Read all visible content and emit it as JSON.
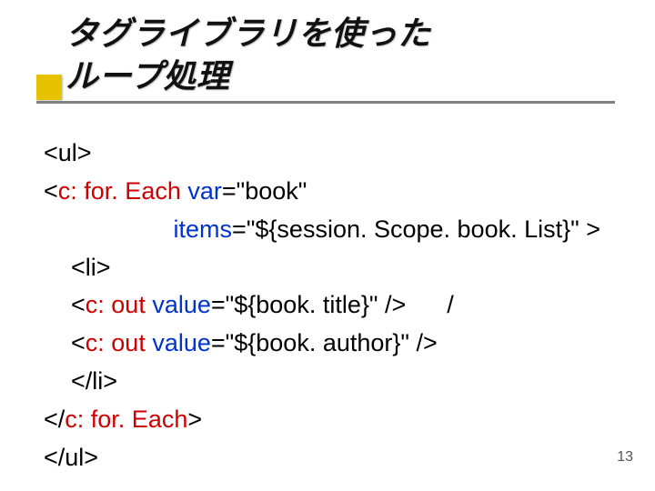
{
  "slide": {
    "title_line1": "タグライブラリを使った",
    "title_line2": "ループ処理",
    "page_number": "13"
  },
  "code": {
    "l1": {
      "t0": "<ul>"
    },
    "l2": {
      "t0": "<",
      "t1": "c: for. Each",
      "t2": " ",
      "t3": "var",
      "t4": "=\"book\""
    },
    "l3": {
      "t0": "                   ",
      "t1": "items",
      "t2": "=\"${session. Scope. book. List}\" >"
    },
    "l4": {
      "t0": "    <li>"
    },
    "l5": {
      "t0": "    <",
      "t1": "c: out",
      "t2": " ",
      "t3": "value",
      "t4": "=\"${book. title}\" />      /"
    },
    "l6": {
      "t0": "    <",
      "t1": "c: out",
      "t2": " ",
      "t3": "value",
      "t4": "=\"${book. author}\" />"
    },
    "l7": {
      "t0": "    </li>"
    },
    "l8": {
      "t0": "</",
      "t1": "c: for. Each",
      "t2": ">"
    },
    "l9": {
      "t0": "</ul>"
    }
  }
}
